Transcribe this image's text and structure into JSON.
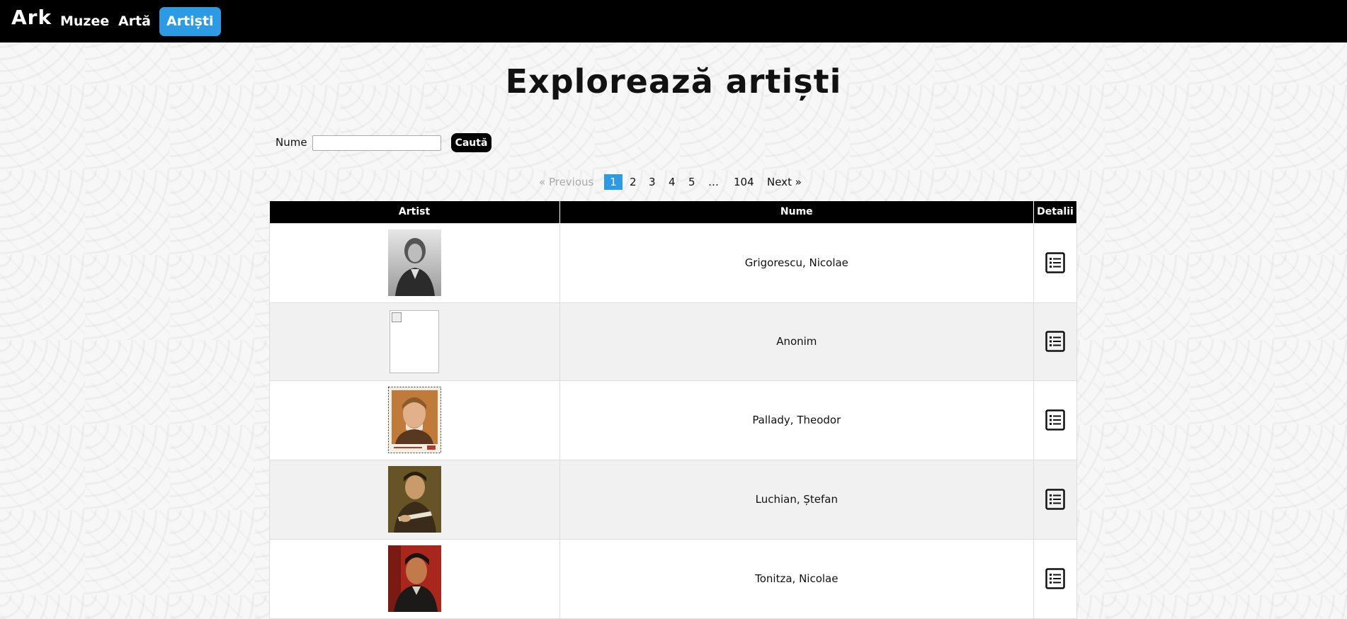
{
  "nav": {
    "brand": "Ark",
    "items": [
      {
        "label": "Muzee",
        "active": false
      },
      {
        "label": "Artă",
        "active": false
      },
      {
        "label": "Artiști",
        "active": true
      }
    ]
  },
  "page": {
    "title": "Explorează artiști"
  },
  "search": {
    "label": "Nume",
    "value": "",
    "placeholder": "",
    "button_label": "Caută"
  },
  "pagination": {
    "previous": "« Previous",
    "pages": [
      "1",
      "2",
      "3",
      "4",
      "5"
    ],
    "current": "1",
    "ellipsis": "…",
    "last": "104",
    "next": "Next »"
  },
  "table": {
    "headers": {
      "artist": "Artist",
      "nume": "Nume",
      "detalii": "Detalii"
    },
    "rows": [
      {
        "name": "Grigorescu, Nicolae",
        "image": "portrait-bw"
      },
      {
        "name": "Anonim",
        "image": "broken-image"
      },
      {
        "name": "Pallady, Theodor",
        "image": "stamp-portrait"
      },
      {
        "name": "Luchian, Ștefan",
        "image": "portrait-painting"
      },
      {
        "name": "Tonitza, Nicolae",
        "image": "portrait-painting-red"
      }
    ]
  },
  "colors": {
    "accent": "#2d9be3",
    "topbar": "#000000"
  }
}
